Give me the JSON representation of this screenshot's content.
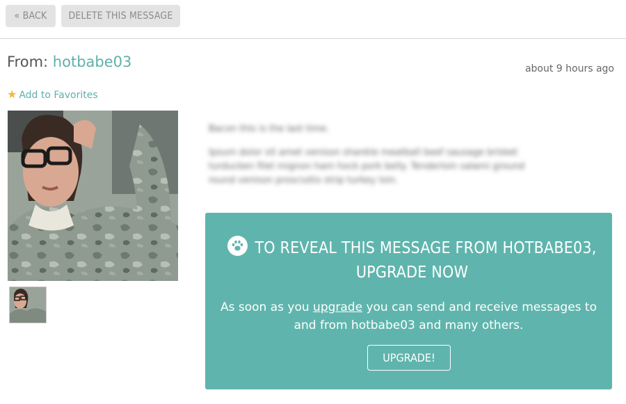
{
  "toolbar": {
    "back_label": "« BACK",
    "delete_label": "DELETE THIS MESSAGE"
  },
  "message": {
    "from_label": "From:",
    "sender": "hotbabe03",
    "timestamp": "about 9 hours ago",
    "add_favorites": "Add to Favorites",
    "blurred_lines": [
      "Bacon this is the last time.",
      "Ipsum dolor sit amet venison shankle meatball beef sausage brisket turducken filet mignon ham hock pork belly. Tenderloin salami ground round venison prosciutto strip turkey loin."
    ]
  },
  "upsell": {
    "title": "TO REVEAL THIS MESSAGE FROM HOTBABE03, UPGRADE NOW",
    "body_before": "As soon as you ",
    "body_link": "upgrade",
    "body_after": " you can send and receive messages to and from hotbabe03 and many others.",
    "button_label": "UPGRADE!",
    "colors": {
      "panel": "#5fb5ad",
      "link": "#5fb0aa",
      "star": "#f6b63c"
    }
  }
}
